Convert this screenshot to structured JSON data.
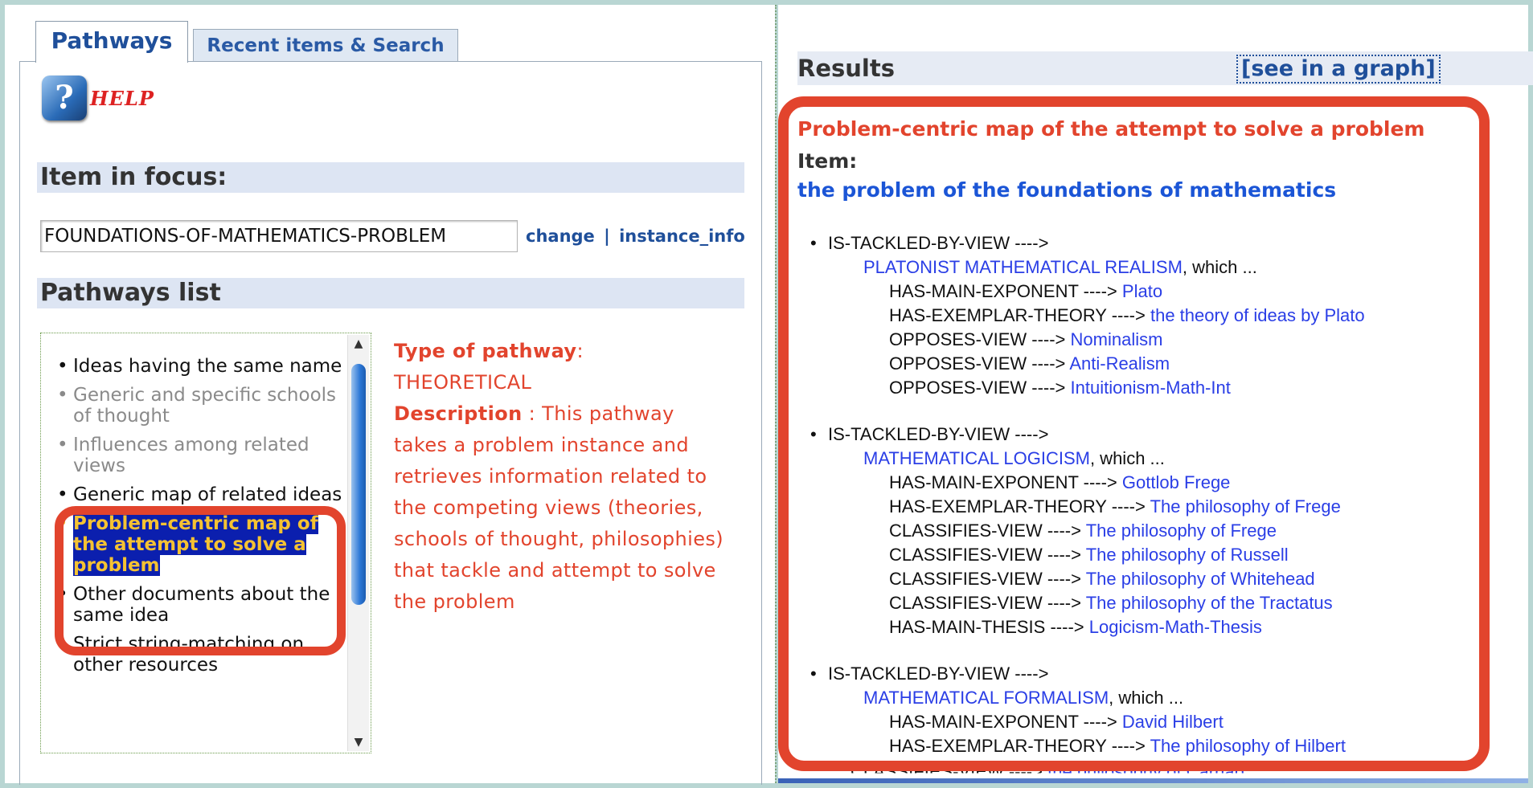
{
  "tabs": {
    "pathways": "Pathways",
    "recent": "Recent items & Search"
  },
  "help": {
    "label": "HELP"
  },
  "focus": {
    "heading": "Item in focus:",
    "value": "FOUNDATIONS-OF-MATHEMATICS-PROBLEM",
    "change": "change",
    "separator": "|",
    "instance_info": "instance_info"
  },
  "pathways_list": {
    "heading": "Pathways list",
    "items": [
      {
        "label": "Ideas having the same name",
        "state": "normal"
      },
      {
        "label": "Generic and specific schools of thought",
        "state": "grey"
      },
      {
        "label": "Influences among related views",
        "state": "grey"
      },
      {
        "label": "Generic map of related ideas",
        "state": "normal"
      },
      {
        "label": "Problem-centric map of the attempt to solve a problem",
        "state": "selected"
      },
      {
        "label": "Other documents about the same idea",
        "state": "normal"
      },
      {
        "label": "Strict string-matching on other resources",
        "state": "normal"
      }
    ]
  },
  "pathway_info": {
    "type_label": "Type of pathway",
    "type_colon": ":",
    "type_value": "THEORETICAL",
    "desc_label": "Description",
    "desc_text": " : This pathway takes a problem instance and retrieves information related to the competing views (theories, schools of thought, philosophies) that tackle and attempt to solve the problem"
  },
  "results": {
    "title": "Results",
    "graph_link": "[see in a graph]",
    "heading": "Problem-centric map of the attempt to solve a problem",
    "item_label": "Item:",
    "item_value": "the problem of the foundations of mathematics",
    "which_suffix": ", which ...",
    "groups": [
      {
        "relation": "IS-TACKLED-BY-VIEW ---->",
        "view": "PLATONIST MATHEMATICAL REALISM",
        "rows": [
          {
            "rel": "HAS-MAIN-EXPONENT ---->",
            "target": "Plato"
          },
          {
            "rel": "HAS-EXEMPLAR-THEORY ---->",
            "target": "the theory of ideas by Plato"
          },
          {
            "rel": "OPPOSES-VIEW ---->",
            "target": "Nominalism"
          },
          {
            "rel": "OPPOSES-VIEW ---->",
            "target": "Anti-Realism"
          },
          {
            "rel": "OPPOSES-VIEW ---->",
            "target": "Intuitionism-Math-Int"
          }
        ]
      },
      {
        "relation": "IS-TACKLED-BY-VIEW ---->",
        "view": "MATHEMATICAL LOGICISM",
        "rows": [
          {
            "rel": "HAS-MAIN-EXPONENT ---->",
            "target": "Gottlob Frege"
          },
          {
            "rel": "HAS-EXEMPLAR-THEORY ---->",
            "target": "The philosophy of Frege"
          },
          {
            "rel": "CLASSIFIES-VIEW ---->",
            "target": "The philosophy of Frege"
          },
          {
            "rel": "CLASSIFIES-VIEW ---->",
            "target": "The philosophy of Russell"
          },
          {
            "rel": "CLASSIFIES-VIEW ---->",
            "target": "The philosophy of Whitehead"
          },
          {
            "rel": "CLASSIFIES-VIEW ---->",
            "target": "The philosophy of the Tractatus"
          },
          {
            "rel": "HAS-MAIN-THESIS ---->",
            "target": "Logicism-Math-Thesis"
          }
        ]
      },
      {
        "relation": "IS-TACKLED-BY-VIEW ---->",
        "view": "MATHEMATICAL FORMALISM",
        "rows": [
          {
            "rel": "HAS-MAIN-EXPONENT ---->",
            "target": "David Hilbert"
          },
          {
            "rel": "HAS-EXEMPLAR-THEORY ---->",
            "target": "The philosophy of Hilbert"
          }
        ]
      }
    ],
    "cut_row": {
      "rel": "CLASSIFIES-VIEW ---->",
      "target": "the philosophy of Carnap"
    }
  },
  "colors": {
    "accent_red": "#e2442d",
    "link_blue": "#2a3ee6",
    "selection_bg": "#0b1fae",
    "selection_fg": "#f5c232"
  }
}
